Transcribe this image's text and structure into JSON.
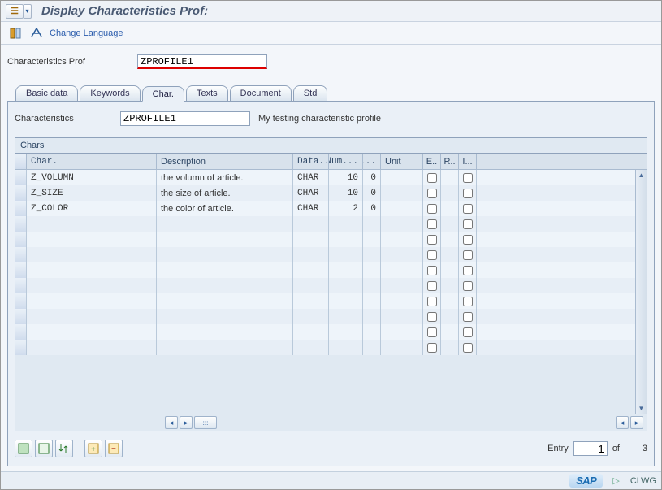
{
  "titlebar": {
    "title": "Display Characteristics Prof:"
  },
  "toolbar2": {
    "change_language": "Change Language"
  },
  "form": {
    "profile_label": "Characteristics Prof",
    "profile_value": "ZPROFILE1"
  },
  "tabs": {
    "basic_data": "Basic data",
    "keywords": "Keywords",
    "char": "Char.",
    "texts": "Texts",
    "document": "Document",
    "std": "Std"
  },
  "char_panel": {
    "characteristics_label": "Characteristics",
    "characteristics_value": "ZPROFILE1",
    "characteristics_desc": "My testing characteristic profile"
  },
  "grid": {
    "title": "Chars",
    "columns": {
      "char": "Char.",
      "desc": "Description",
      "data": "Data...",
      "num": "Num...",
      "d": "D...",
      "unit": "Unit",
      "e": "E..",
      "r": "R..",
      "i": "I..."
    },
    "rows": [
      {
        "char": "Z_VOLUMN",
        "desc": "the volumn of article.",
        "data": "CHAR",
        "num": "10",
        "d": "0",
        "unit": ""
      },
      {
        "char": "Z_SIZE",
        "desc": "the size of article.",
        "data": "CHAR",
        "num": "10",
        "d": "0",
        "unit": ""
      },
      {
        "char": "Z_COLOR",
        "desc": "the color of article.",
        "data": "CHAR",
        "num": "2",
        "d": "0",
        "unit": ""
      }
    ],
    "empty_rows": 9
  },
  "footer": {
    "entry_label": "Entry",
    "entry_value": "1",
    "of_label": "of",
    "total": "3"
  },
  "statusbar": {
    "sap": "SAP",
    "system": "CLWG"
  }
}
